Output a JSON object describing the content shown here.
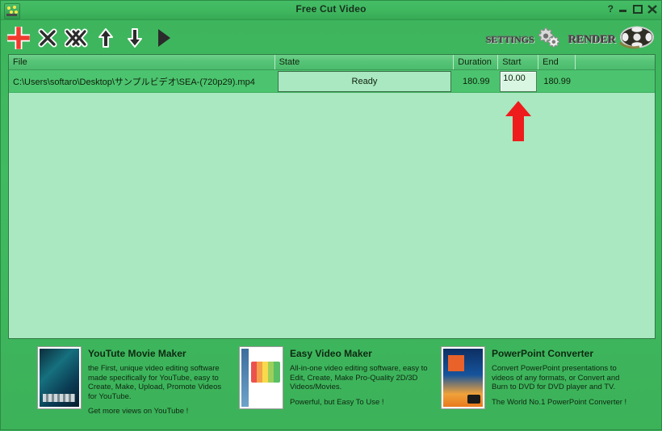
{
  "window": {
    "title": "Free Cut Video",
    "app_icon": "app-icon",
    "controls": {
      "help": "?",
      "minimize": "minimize-icon",
      "maximize": "maximize-icon",
      "close": "close-icon"
    }
  },
  "toolbar": {
    "left_buttons": [
      {
        "name": "add-file-button",
        "icon": "plus-icon",
        "label": "Add"
      },
      {
        "name": "remove-file-button",
        "icon": "x-icon",
        "label": "Remove"
      },
      {
        "name": "remove-all-button",
        "icon": "double-x-icon",
        "label": "Remove All"
      },
      {
        "name": "move-up-button",
        "icon": "arrow-up-icon",
        "label": "Move Up"
      },
      {
        "name": "move-down-button",
        "icon": "arrow-down-icon",
        "label": "Move Down"
      },
      {
        "name": "play-button",
        "icon": "play-triangle-icon",
        "label": "Play"
      }
    ],
    "settings_label": "Settings",
    "render_label": "Render"
  },
  "list": {
    "columns": [
      {
        "key": "file",
        "label": "File"
      },
      {
        "key": "state",
        "label": "State"
      },
      {
        "key": "duration",
        "label": "Duration"
      },
      {
        "key": "start",
        "label": "Start"
      },
      {
        "key": "end",
        "label": "End"
      },
      {
        "key": "tail",
        "label": ""
      }
    ],
    "rows": [
      {
        "file": "C:\\Users\\softaro\\Desktop\\サンプルビデオ\\SEA-(720p29).mp4",
        "state": "Ready",
        "duration": "180.99",
        "start": "10.00",
        "end": "180.99"
      }
    ]
  },
  "annotation": {
    "arrow_color": "#ee1c1c",
    "points_at": "start-value-input"
  },
  "ads": [
    {
      "title": "YouTute Movie Maker",
      "desc": "the First, unique video editing software\nmade specifically for YouTube, easy to\nCreate, Make, Upload, Promote Videos\nfor YouTube.",
      "tag": "Get more views on YouTube !"
    },
    {
      "title": "Easy Video Maker",
      "desc": "All-in-one video editing software, easy to\nEdit, Create, Make Pro-Quality 2D/3D\nVideos/Movies.",
      "tag": "Powerful, but Easy To Use !"
    },
    {
      "title": "PowerPoint Converter",
      "desc": "Convert PowerPoint presentations to\nvideos of any formats, or Convert and\nBurn to DVD for DVD player and TV.",
      "tag": "The World No.1 PowerPoint Converter !"
    }
  ],
  "colors": {
    "window_green": "#3fb75f",
    "header_green": "#55c476",
    "row_green": "#4cc46f",
    "list_background": "#a9e8c0",
    "accent_red": "#ee1c1c"
  }
}
